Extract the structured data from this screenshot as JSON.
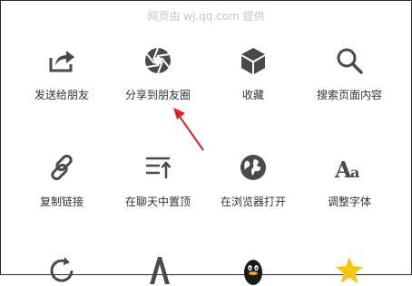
{
  "header": {
    "provider_text": "网页由 wj.qq.com 提供"
  },
  "menu": {
    "row1": [
      {
        "label": "发送给朋友",
        "icon": "share-forward-icon"
      },
      {
        "label": "分享到朋友圈",
        "icon": "moments-shutter-icon"
      },
      {
        "label": "收藏",
        "icon": "favorite-cube-icon"
      },
      {
        "label": "搜索页面内容",
        "icon": "search-icon"
      }
    ],
    "row2": [
      {
        "label": "复制链接",
        "icon": "link-icon"
      },
      {
        "label": "在聊天中置顶",
        "icon": "pin-to-top-icon"
      },
      {
        "label": "在浏览器打开",
        "icon": "globe-icon"
      },
      {
        "label": "调整字体",
        "icon": "font-size-icon"
      }
    ],
    "row3": [
      {
        "icon": "refresh-icon"
      },
      {
        "icon": "font-a-icon"
      },
      {
        "icon": "qq-penguin-icon"
      },
      {
        "icon": "star-icon"
      }
    ]
  },
  "annotation": {
    "arrow_color": "#e0201f",
    "points_to": "分享到朋友圈"
  },
  "colors": {
    "icon": "#4a4a4a",
    "label": "#333333",
    "provider": "#c4c4c4",
    "star": "#f5c518"
  }
}
